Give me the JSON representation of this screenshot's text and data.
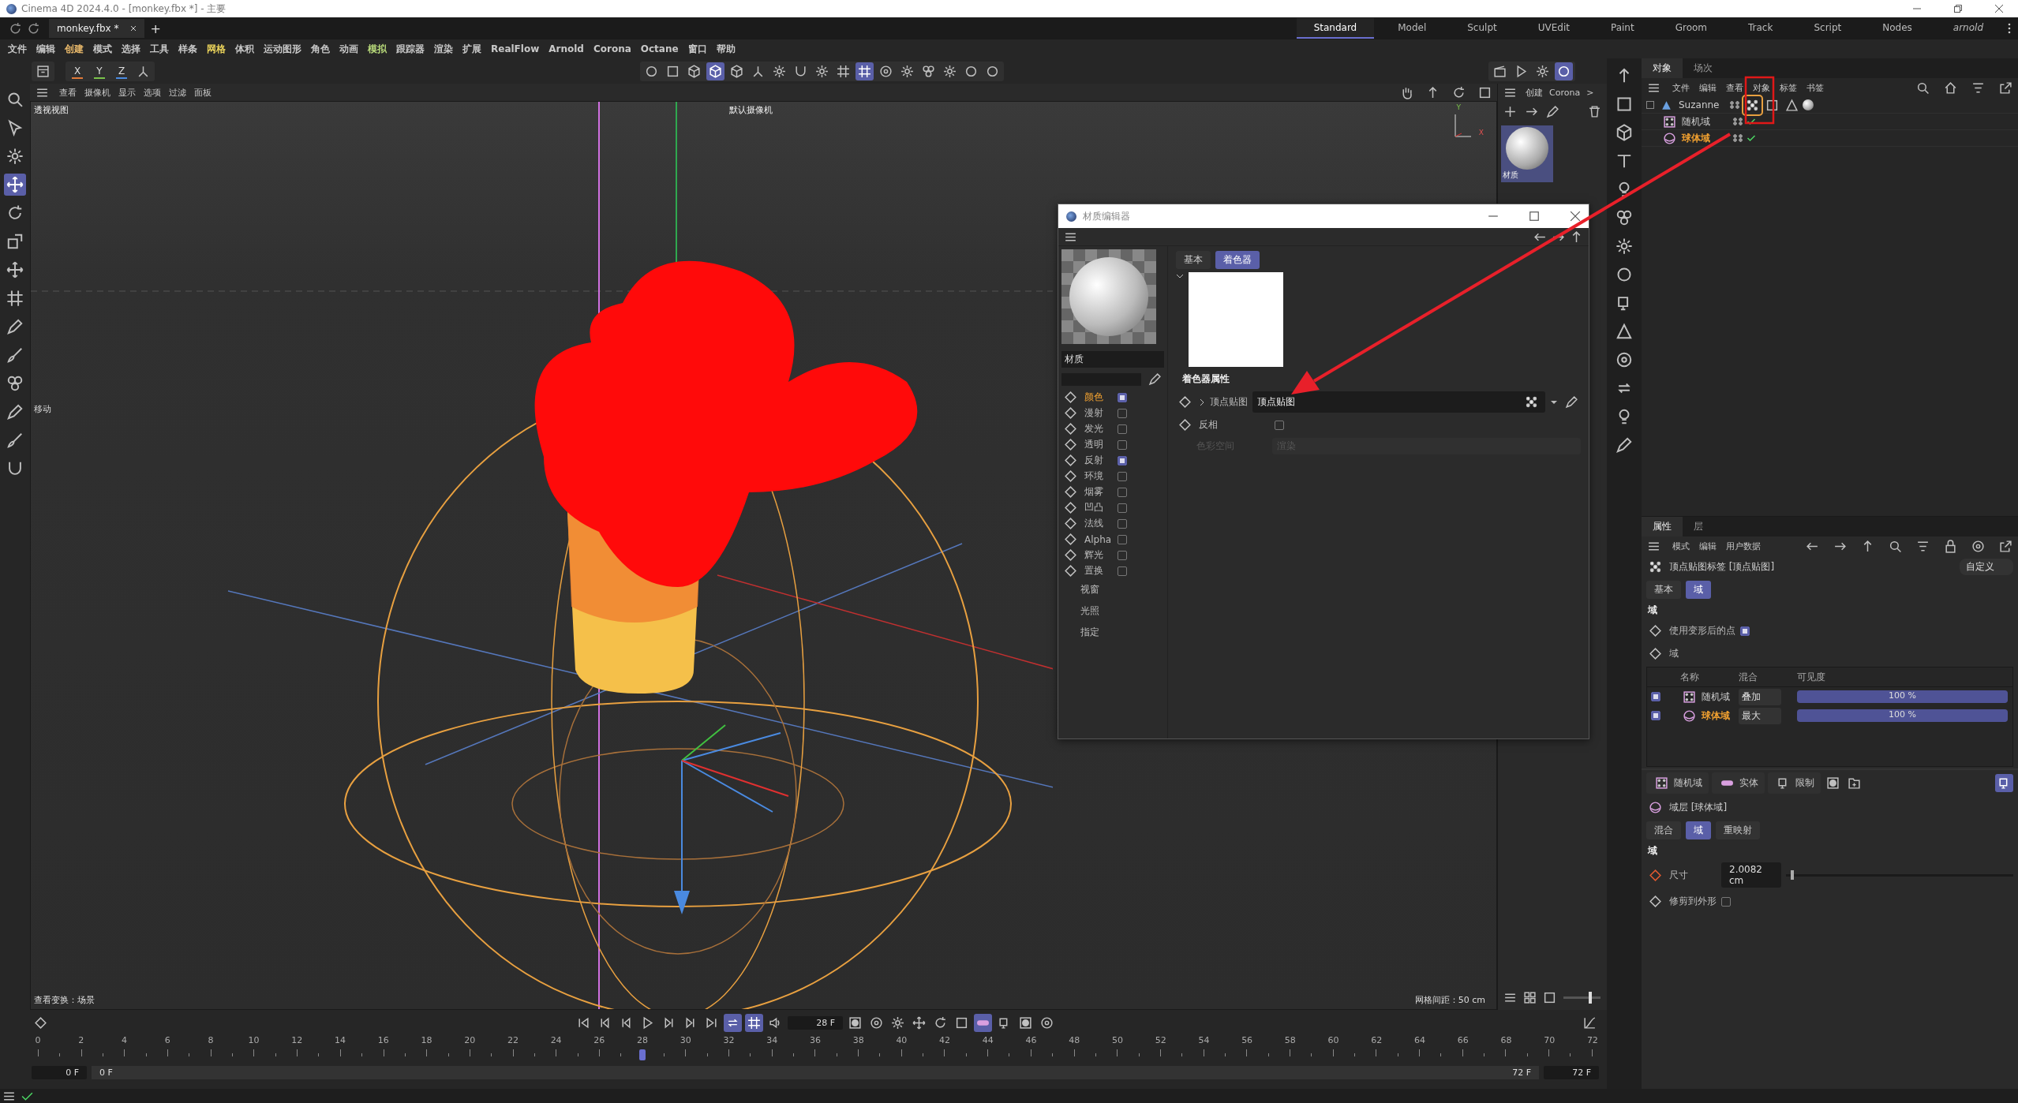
{
  "window": {
    "title": "Cinema 4D 2024.4.0 - [monkey.fbx *] - 主要",
    "document_tab": "monkey.fbx *",
    "new_tab": "+"
  },
  "layouts": [
    {
      "label": "Standard",
      "selected": true
    },
    {
      "label": "Model",
      "selected": false
    },
    {
      "label": "Sculpt",
      "selected": false
    },
    {
      "label": "UVEdit",
      "selected": false
    },
    {
      "label": "Paint",
      "selected": false
    },
    {
      "label": "Groom",
      "selected": false
    },
    {
      "label": "Track",
      "selected": false
    },
    {
      "label": "Script",
      "selected": false
    },
    {
      "label": "Nodes",
      "selected": false
    },
    {
      "label": "arnold",
      "selected": false
    }
  ],
  "menu": [
    {
      "label": "文件",
      "color": "#c8c8c8"
    },
    {
      "label": "编辑",
      "color": "#c8c8c8"
    },
    {
      "label": "创建",
      "color": "#e8b86a"
    },
    {
      "label": "模式",
      "color": "#c8c8c8"
    },
    {
      "label": "选择",
      "color": "#c8c8c8"
    },
    {
      "label": "工具",
      "color": "#c8c8c8"
    },
    {
      "label": "样条",
      "color": "#c8c8c8"
    },
    {
      "label": "网格",
      "color": "#e8d15a"
    },
    {
      "label": "体积",
      "color": "#c8c8c8"
    },
    {
      "label": "运动图形",
      "color": "#c8c8c8"
    },
    {
      "label": "角色",
      "color": "#c8c8c8"
    },
    {
      "label": "动画",
      "color": "#c8c8c8"
    },
    {
      "label": "模拟",
      "color": "#b8d97a"
    },
    {
      "label": "跟踪器",
      "color": "#c8c8c8"
    },
    {
      "label": "渲染",
      "color": "#c8c8c8"
    },
    {
      "label": "扩展",
      "color": "#c8c8c8"
    },
    {
      "label": "RealFlow",
      "color": "#c8c8c8"
    },
    {
      "label": "Arnold",
      "color": "#c8c8c8"
    },
    {
      "label": "Corona",
      "color": "#c8c8c8"
    },
    {
      "label": "Octane",
      "color": "#c8c8c8"
    },
    {
      "label": "窗口",
      "color": "#c8c8c8"
    },
    {
      "label": "帮助",
      "color": "#c8c8c8"
    }
  ],
  "axis_buttons": [
    {
      "label": "X",
      "color": "#e07a3a"
    },
    {
      "label": "Y",
      "color": "#7ac24a"
    },
    {
      "label": "Z",
      "color": "#4a8ae0"
    }
  ],
  "viewport": {
    "menu": [
      "查看",
      "摄像机",
      "显示",
      "选项",
      "过滤",
      "面板"
    ],
    "view_name": "透视视图",
    "camera": "默认摄像机",
    "tool_label": "移动",
    "status_left": "查看变换：场景",
    "status_right": "网格间距：50 cm",
    "axis_labels": [
      "Y",
      "X"
    ]
  },
  "material_manager": {
    "menu": [
      "创建",
      "Corona",
      ">"
    ],
    "materials": [
      {
        "name": "材质",
        "selected": true
      }
    ],
    "thumbnail_size": {
      "level": 0.75
    }
  },
  "object_manager": {
    "tabs": [
      {
        "label": "对象",
        "selected": true
      },
      {
        "label": "场次",
        "selected": false
      }
    ],
    "menu": [
      "文件",
      "编辑",
      "查看",
      "对象",
      "标签",
      "书签"
    ],
    "tree": [
      {
        "name": "Suzanne",
        "kind": "mesh",
        "selected": false,
        "children": [
          {
            "name": "随机域",
            "kind": "random",
            "selected": false,
            "enabled": true
          },
          {
            "name": "球体域",
            "kind": "sphere",
            "selected": true,
            "enabled": true
          }
        ]
      }
    ]
  },
  "attributes": {
    "tabs": [
      {
        "label": "属性",
        "selected": true
      },
      {
        "label": "层",
        "selected": false
      }
    ],
    "menu": [
      "模式",
      "编辑",
      "用户数据"
    ],
    "title": "顶点贴图标签 [顶点贴图]",
    "preset": "自定义",
    "sub_tabs": [
      {
        "label": "基本",
        "selected": false
      },
      {
        "label": "域",
        "selected": true
      }
    ],
    "section": "域",
    "use_deformed": {
      "label": "使用变形后的点",
      "checked": true
    },
    "fields_label": "域",
    "columns": [
      "名称",
      "混合",
      "可见度"
    ],
    "fields": [
      {
        "name": "随机域",
        "kind": "random",
        "enabled": true,
        "selected": false,
        "blend": "叠加",
        "visibility": "100 %",
        "level": 1.0
      },
      {
        "name": "球体域",
        "kind": "sphere",
        "enabled": true,
        "selected": true,
        "blend": "最大",
        "visibility": "100 %",
        "level": 1.0
      }
    ],
    "add_buttons": [
      {
        "label": "随机域",
        "kind": "random"
      },
      {
        "label": "实体",
        "kind": "solid"
      },
      {
        "label": "限制",
        "kind": "clamp"
      }
    ],
    "layer_title": "域层 [球体域]",
    "layer_tabs": [
      {
        "label": "混合",
        "selected": false
      },
      {
        "label": "域",
        "selected": true
      },
      {
        "label": "重映射",
        "selected": false
      }
    ],
    "layer_section": "域",
    "size": {
      "label": "尺寸",
      "value": "2.0082 cm",
      "level": 0.02
    },
    "clip": {
      "label": "修剪到外形",
      "checked": false
    }
  },
  "material_editor": {
    "title": "材质编辑器",
    "name": "材质",
    "channels": [
      {
        "label": "颜色",
        "checked": true,
        "selected": true
      },
      {
        "label": "漫射",
        "checked": false,
        "selected": false
      },
      {
        "label": "发光",
        "checked": false,
        "selected": false
      },
      {
        "label": "透明",
        "checked": false,
        "selected": false
      },
      {
        "label": "反射",
        "checked": true,
        "selected": false
      },
      {
        "label": "环境",
        "checked": false,
        "selected": false
      },
      {
        "label": "烟雾",
        "checked": false,
        "selected": false
      },
      {
        "label": "凹凸",
        "checked": false,
        "selected": false
      },
      {
        "label": "法线",
        "checked": false,
        "selected": false
      },
      {
        "label": "Alpha",
        "checked": false,
        "selected": false
      },
      {
        "label": "辉光",
        "checked": false,
        "selected": false
      },
      {
        "label": "置换",
        "checked": false,
        "selected": false
      }
    ],
    "extra_items": [
      "视窗",
      "光照",
      "指定"
    ],
    "tabs": [
      {
        "label": "基本",
        "selected": false
      },
      {
        "label": "着色器",
        "selected": true
      }
    ],
    "section": "着色器属性",
    "shader": {
      "label": "顶点贴图",
      "value": "顶点贴图"
    },
    "invert": {
      "label": "反相",
      "checked": false
    },
    "color_space": {
      "label": "色彩空间",
      "value": "渲染",
      "disabled": true
    }
  },
  "timeline": {
    "current_frame": "28 F",
    "ruler": [
      "0",
      "2",
      "4",
      "6",
      "8",
      "10",
      "12",
      "14",
      "16",
      "18",
      "20",
      "22",
      "24",
      "26",
      "28",
      "30",
      "32",
      "34",
      "36",
      "38",
      "40",
      "42",
      "44",
      "46",
      "48",
      "50",
      "52",
      "54",
      "56",
      "58",
      "60",
      "62",
      "64",
      "66",
      "68",
      "70",
      "72"
    ],
    "playhead": {
      "level": 0.389
    },
    "start": "0 F",
    "range_start": "0 F",
    "range_end": "72 F",
    "end": "72 F"
  }
}
